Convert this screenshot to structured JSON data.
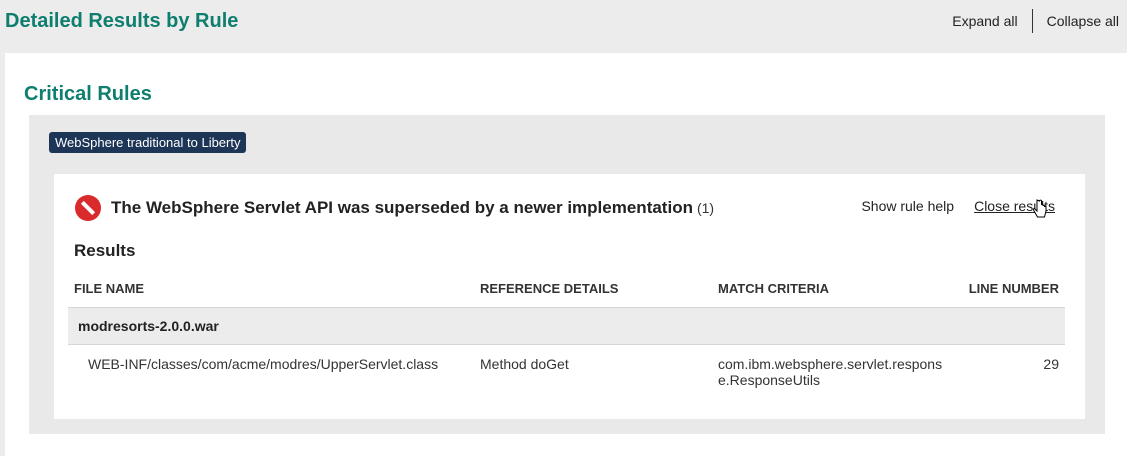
{
  "header": {
    "title": "Detailed Results by Rule",
    "expand_all": "Expand all",
    "collapse_all": "Collapse all"
  },
  "section": {
    "title": "Critical Rules",
    "tag": "WebSphere traditional to Liberty"
  },
  "rule": {
    "title": "The WebSphere Servlet API was superseded by a newer implementation",
    "count": "(1)",
    "show_help": "Show rule help",
    "close_results": "Close results",
    "results_label": "Results",
    "icon": "error-icon"
  },
  "table": {
    "columns": [
      "FILE NAME",
      "REFERENCE DETAILS",
      "MATCH CRITERIA",
      "LINE NUMBER"
    ],
    "group": "modresorts-2.0.0.war",
    "rows": [
      {
        "file": "WEB-INF/classes/com/acme/modres/UpperServlet.class",
        "reference": "Method doGet",
        "match": "com.ibm.websphere.servlet.response.ResponseUtils",
        "line": "29"
      }
    ]
  },
  "colors": {
    "accent": "#0e7e6e",
    "tag_bg": "#1d3557",
    "error": "#d92b2b"
  }
}
